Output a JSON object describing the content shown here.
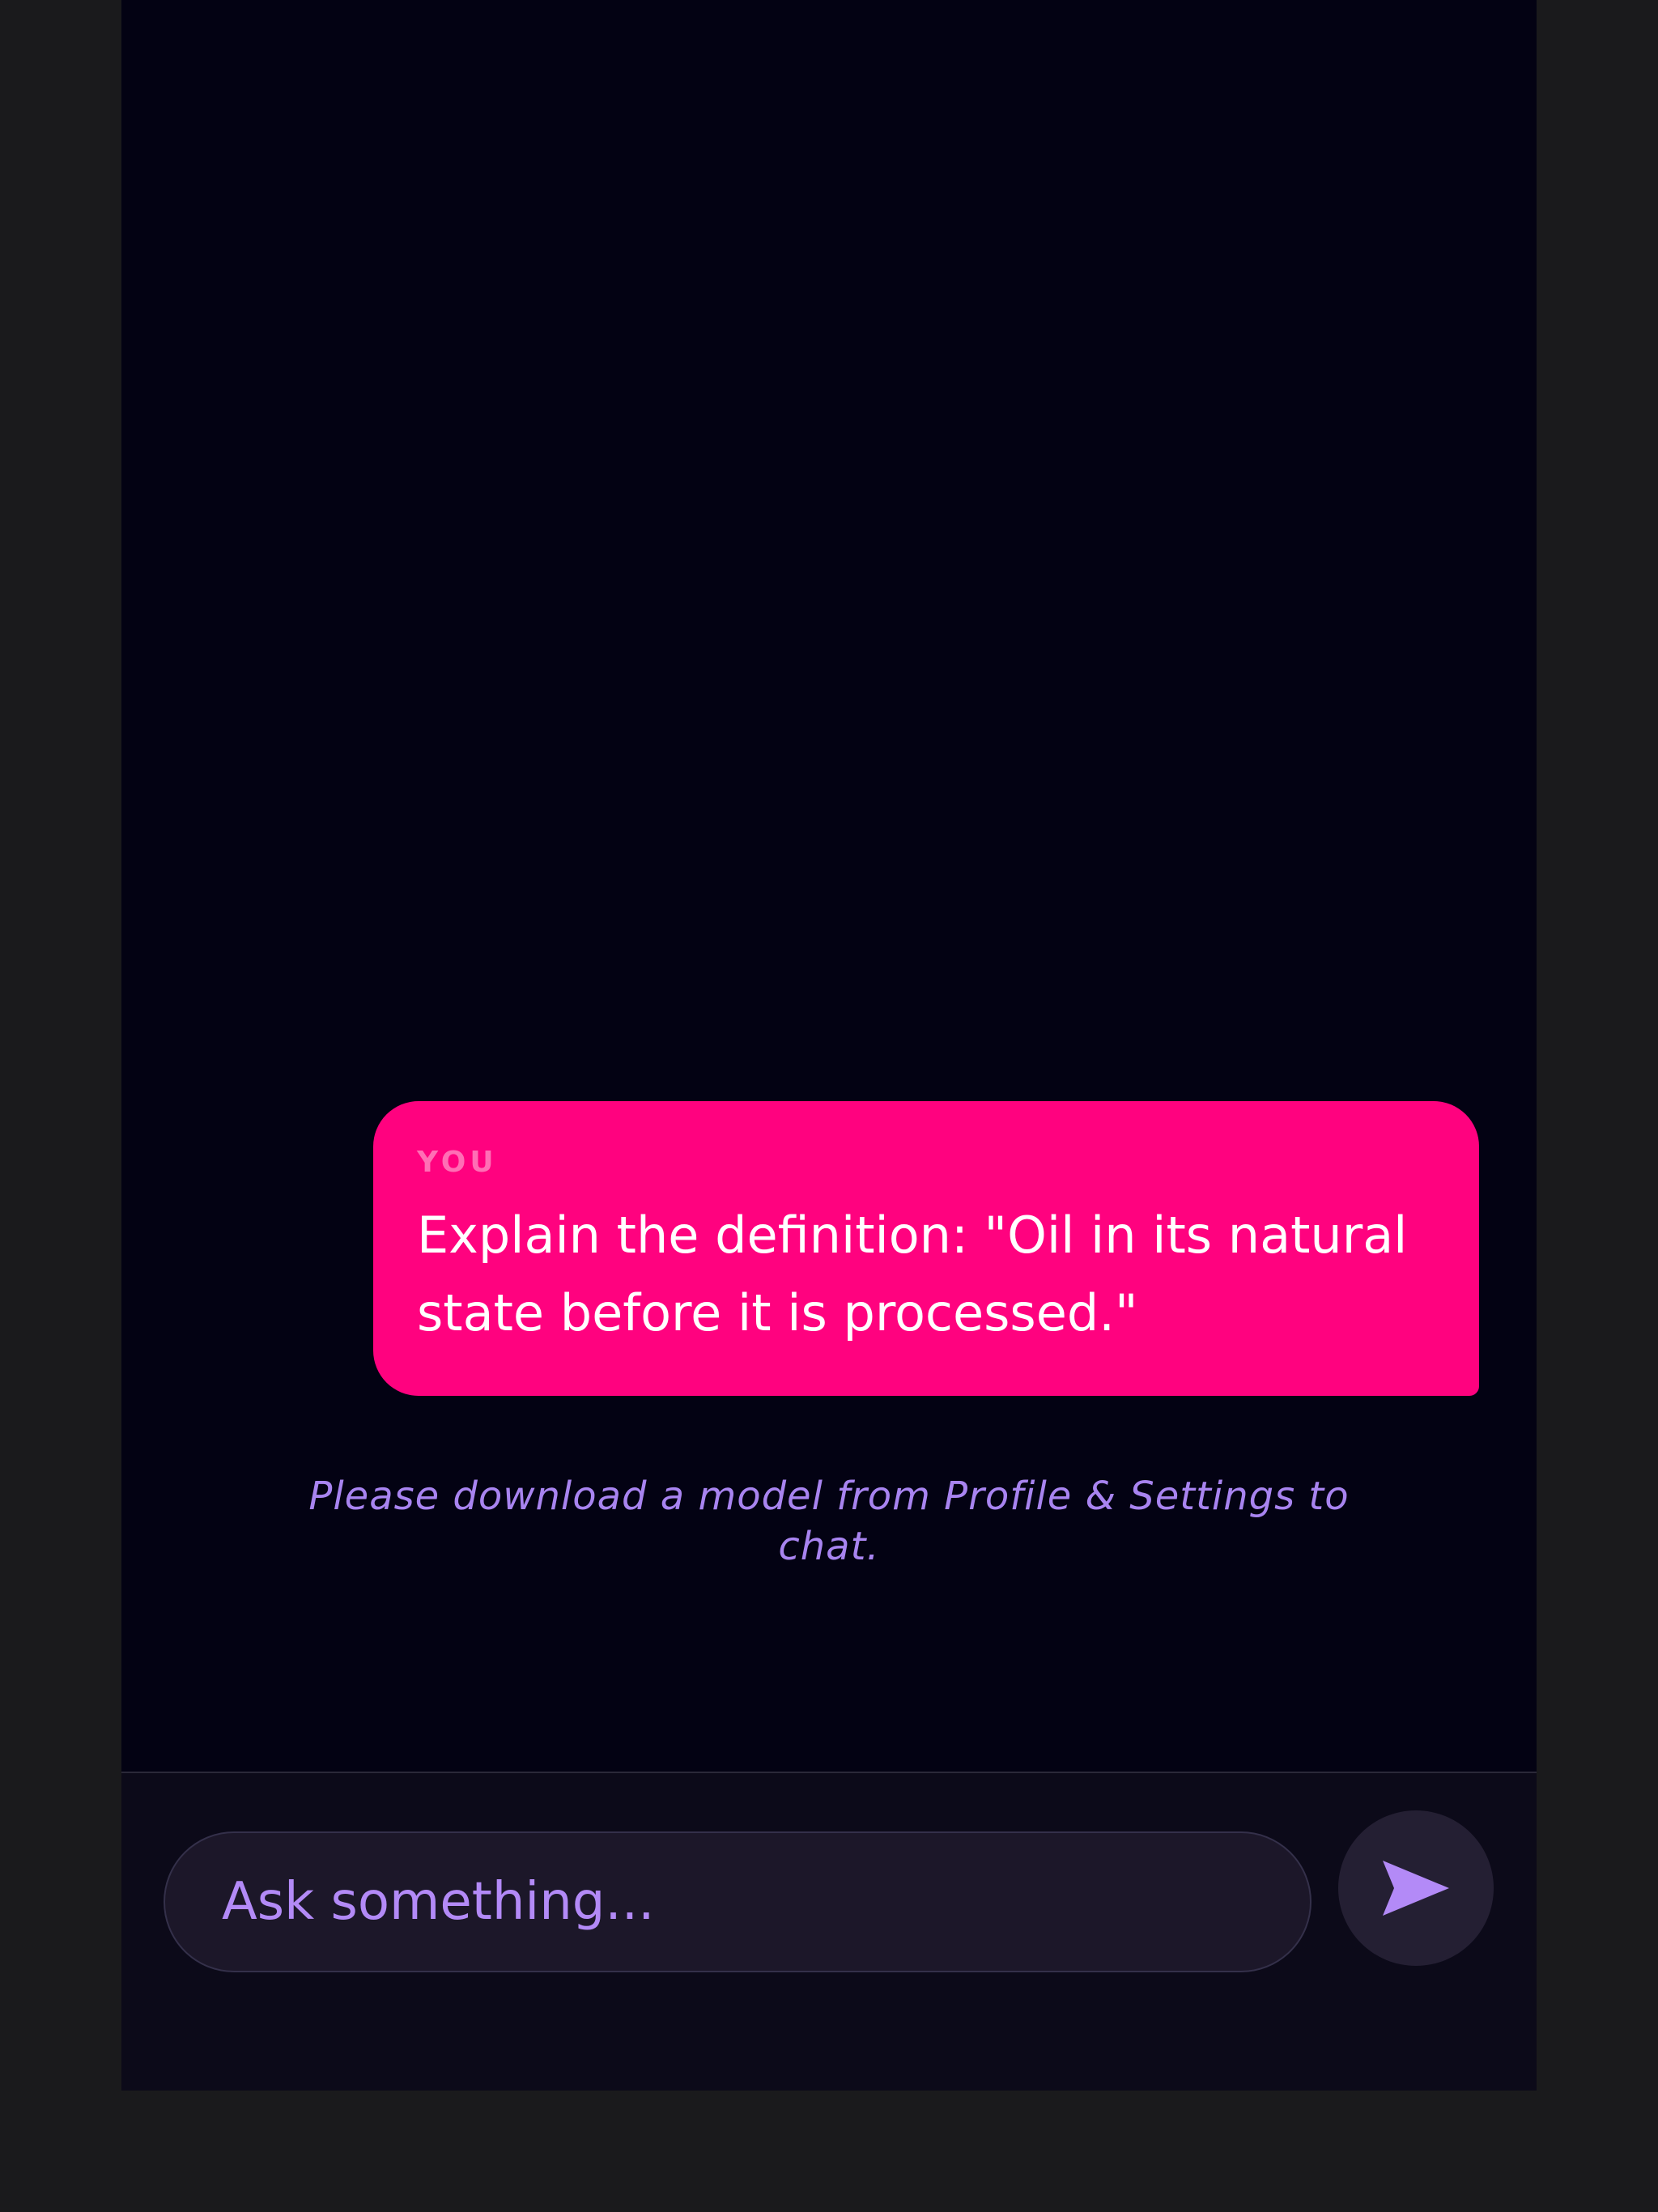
{
  "conversation": {
    "messages": [
      {
        "sender": "YOU",
        "text": "Explain the definition: \"Oil in its natural state before it is processed.\""
      }
    ],
    "system_notice": "Please download a model from Profile & Settings to chat."
  },
  "composer": {
    "input_value": "",
    "input_placeholder": "Ask something...",
    "send_icon": "send-icon"
  },
  "colors": {
    "page_background": "#1a1a1c",
    "app_background": "#030213",
    "user_bubble": "#ff027f",
    "accent": "#b38af7",
    "composer_background": "#0c0a19"
  }
}
